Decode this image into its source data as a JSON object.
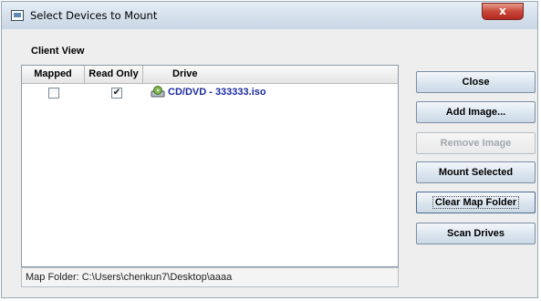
{
  "window": {
    "title": "Select Devices to Mount",
    "close_glyph": "x"
  },
  "client_view": {
    "label": "Client View",
    "columns": [
      "Mapped",
      "Read Only",
      "Drive"
    ],
    "rows": [
      {
        "mapped": false,
        "read_only": true,
        "drive": "CD/DVD - 333333.iso",
        "icon": "cd-drive-icon"
      }
    ],
    "checked_glyph": "✔"
  },
  "map_folder": "Map Folder: C:\\Users\\chenkun7\\Desktop\\aaaa",
  "buttons": {
    "close": "Close",
    "add_image": "Add Image...",
    "remove_image": "Remove Image",
    "mount_selected": "Mount Selected",
    "clear_map_folder": "Clear Map Folder",
    "scan_drives": "Scan Drives"
  },
  "colors": {
    "drive_text": "#1b2aa0",
    "close_button": "#c9483a"
  }
}
